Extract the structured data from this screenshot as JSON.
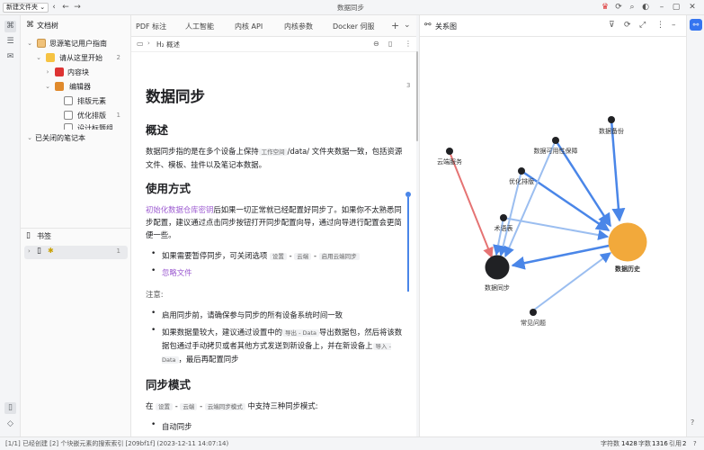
{
  "titlebar": {
    "workspace_label": "新建文件夹 ⌄",
    "title": "数据同步"
  },
  "filetree": {
    "header": "文档树",
    "items": [
      {
        "label": "思源笔记用户指南",
        "count": ""
      },
      {
        "label": "请从这里开始",
        "count": "2"
      },
      {
        "label": "内容块",
        "count": ""
      },
      {
        "label": "编辑器",
        "count": ""
      },
      {
        "label": "排版元素",
        "count": ""
      },
      {
        "label": "优化排版",
        "count": "1"
      },
      {
        "label": "设计标题组",
        "count": ""
      }
    ],
    "closed_notebooks": "已关闭的笔记本",
    "bookmarks_header": "书签",
    "bookmark_count": "1"
  },
  "editor": {
    "tabs": [
      "PDF 标注",
      "人工智能",
      "内核 API",
      "内核参数",
      "Docker 伺服"
    ],
    "breadcrumb": "H₂ 概述",
    "block_count": "3",
    "doc": {
      "title": "数据同步",
      "h_overview": "概述",
      "p_overview_1": "数据同步指的是在多个设备上保持",
      "code_workspace": "工作空间",
      "p_overview_2": "/data/ 文件夹数据一致，包括资源文件、模板、挂件以及笔记本数据。",
      "h_usage": "使用方式",
      "link_init": "初始化数据仓库密钥",
      "p_usage": "后如果一切正常就已经配置好同步了。如果你不太熟悉同步配置，建议通过点击同步按钮打开同步配置向导，通过向导进行配置会更简便一些。",
      "li_pause_1": "如果需要暂停同步，可关闭选项",
      "code_settings": "设置",
      "code_cloud": "云端",
      "code_enable": "启用云端同步",
      "link_ignore": "忽略文件",
      "note_label": "注意:",
      "li_note_1": "启用同步前，请确保参与同步的所有设备系统时间一致",
      "li_note_2a": "如果数据量较大，建议通过设置中的",
      "code_export": "导出 - Data",
      "li_note_2b": "导出数据包，然后将该数据包通过手动拷贝或者其他方式发送到新设备上，并在新设备上",
      "code_import": "导入 - Data",
      "li_note_2c": "，最后再配置同步",
      "h_mode": "同步模式",
      "p_mode_1": "在",
      "code_mode": "云端同步模式",
      "p_mode_2": "中支持三种同步模式:",
      "li_auto": "自动同步"
    }
  },
  "graph": {
    "header": "关系图",
    "nodes": [
      {
        "label": "数据备份"
      },
      {
        "label": "云端服务"
      },
      {
        "label": "数据可用性保障"
      },
      {
        "label": "优化排版"
      },
      {
        "label": "术语表"
      },
      {
        "label": "数据同步"
      },
      {
        "label": "数据历史"
      },
      {
        "label": "常见问题"
      }
    ],
    "colors": {
      "edge_blue": "#4a86e8",
      "edge_red": "#e57373",
      "node_orange": "#f2a93b",
      "node_dark": "#202124"
    }
  },
  "statusbar": {
    "left": "[1/1] 已经创建 [2] 个块嵌元素的搜索索引 [209bf1f] (2023-12-11 14:07:14)",
    "word_label": "字符数",
    "word_value": "1428",
    "char_label": "字数",
    "char_value": "1316",
    "ref_label": "引用",
    "ref_value": "2"
  }
}
